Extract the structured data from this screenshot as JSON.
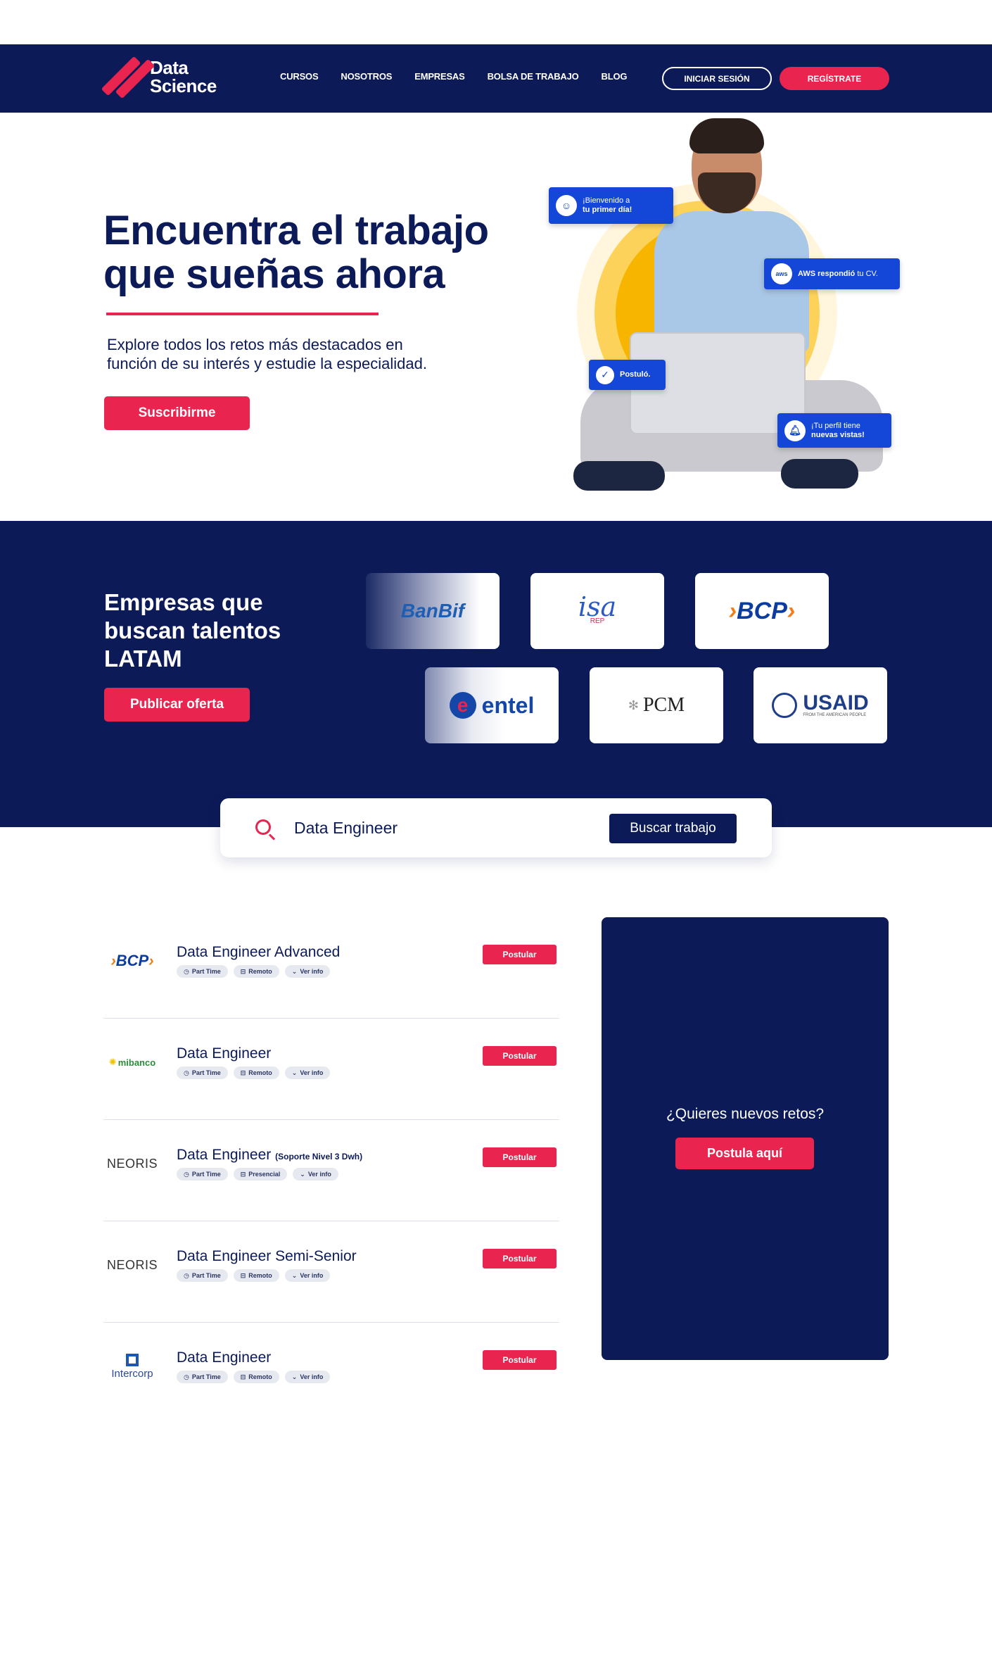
{
  "nav": {
    "logo_line1": "Data",
    "logo_line2": "Science",
    "links": [
      "CURSOS",
      "NOSOTROS",
      "EMPRESAS",
      "BOLSA DE TRABAJO",
      "BLOG"
    ],
    "login_label": "INICIAR SESIÓN",
    "register_label": "REGÍSTRATE"
  },
  "hero": {
    "title_line1": "Encuentra el trabajo",
    "title_line2": "que sueñas ahora",
    "subtitle_line1": "Explore todos los retos más destacados en",
    "subtitle_line2": "función de su interés y estudie la especialidad.",
    "cta_label": "Suscribirme",
    "notifications": {
      "welcome_line1": "¡Bienvenido a",
      "welcome_line2": "tu primer día!",
      "aws_logo": "aws",
      "aws_bold": "AWS respondió",
      "aws_rest": " tu CV.",
      "applied": "Postuló.",
      "views_line1": "¡Tu perfil tiene",
      "views_line2": "nuevas vistas!"
    }
  },
  "companies": {
    "title": "Empresas que buscan talentos LATAM",
    "cta_label": "Publicar oferta",
    "logos": {
      "banbif": "BanBif",
      "isa": "isa",
      "isa_sub": "REP",
      "bcp": "BCP",
      "entel": "entel",
      "pcm": "PCM",
      "usaid": "USAID",
      "usaid_sub": "FROM THE AMERICAN PEOPLE"
    }
  },
  "search": {
    "value": "Data Engineer",
    "button_label": "Buscar trabajo"
  },
  "jobs": [
    {
      "company": "BCP",
      "title": "Data Engineer Advanced",
      "title_note": "",
      "tags": [
        "Part Time",
        "Remoto",
        "Ver info"
      ],
      "apply": "Postular"
    },
    {
      "company": "mibanco",
      "title": "Data Engineer",
      "title_note": "",
      "tags": [
        "Part Time",
        "Remoto",
        "Ver info"
      ],
      "apply": "Postular"
    },
    {
      "company": "NEORIS",
      "title": "Data Engineer",
      "title_note": "(Soporte Nivel 3 Dwh)",
      "tags": [
        "Part Time",
        "Presencial",
        "Ver info"
      ],
      "apply": "Postular"
    },
    {
      "company": "NEORIS",
      "title": "Data Engineer Semi-Senior",
      "title_note": "",
      "tags": [
        "Part Time",
        "Remoto",
        "Ver info"
      ],
      "apply": "Postular"
    },
    {
      "company": "Intercorp",
      "title": "Data Engineer",
      "title_note": "",
      "tags": [
        "Part Time",
        "Remoto",
        "Ver info"
      ],
      "apply": "Postular"
    }
  ],
  "side": {
    "question": "¿Quieres nuevos retos?",
    "cta_label": "Postula aquí"
  },
  "colors": {
    "navy": "#0c1b58",
    "accent": "#e8244f",
    "chip_blue": "#1446d8"
  }
}
